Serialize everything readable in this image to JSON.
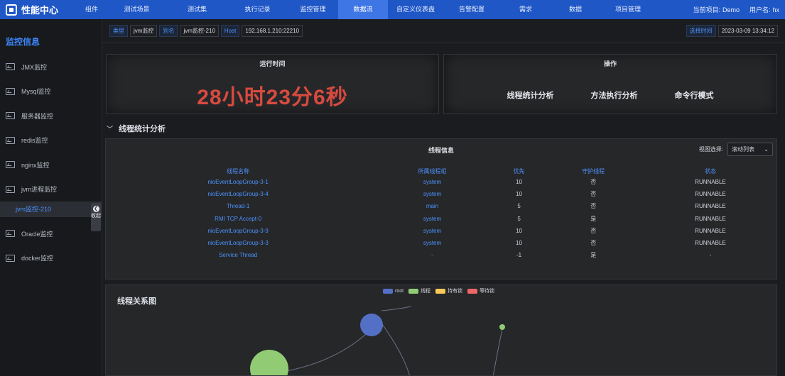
{
  "app": {
    "title": "性能中心"
  },
  "nav": [
    {
      "label": "组件",
      "w": 42
    },
    {
      "label": "测试场景",
      "w": 85
    },
    {
      "label": "测试集",
      "w": 85
    },
    {
      "label": "执行记录",
      "w": 85
    },
    {
      "label": "监控管理",
      "w": 71
    },
    {
      "label": "数据流",
      "w": 70,
      "active": true
    },
    {
      "label": "自定义仪表盘",
      "w": 78
    },
    {
      "label": "告警配置",
      "w": 80
    },
    {
      "label": "需求",
      "w": 72
    },
    {
      "label": "数据",
      "w": 68
    },
    {
      "label": "项目管理",
      "w": 80
    }
  ],
  "top_right": {
    "project_label": "当前项目:",
    "project": "Demo",
    "user_label": "用户名:",
    "user": "hx"
  },
  "sidebar": {
    "title": "监控信息",
    "items": [
      "JMX监控",
      "Mysql监控",
      "服务器监控",
      "redis监控",
      "nginx监控",
      "jvm进程监控"
    ],
    "sub_item": "jvm监控-210",
    "items_after": [
      "Oracle监控",
      "docker监控"
    ],
    "collapse": {
      "icon": "❮",
      "text": "收起"
    }
  },
  "infobar": {
    "type_label": "类型",
    "type_value": "jvm监控",
    "alias_label": "别名",
    "alias_value": "jvm监控-210",
    "host_label": "Host",
    "host_value": "192.168.1.210:22210",
    "time_label": "选择时间",
    "time_value": "2023-03-09 13:34:12"
  },
  "runtime": {
    "title": "运行时间",
    "value": "28小时23分6秒"
  },
  "ops": {
    "title": "操作",
    "items": [
      "线程统计分析",
      "方法执行分析",
      "命令行模式"
    ]
  },
  "section": {
    "title": "线程统计分析"
  },
  "thread_panel": {
    "title": "线程信息",
    "view_label": "视图选择:",
    "view_value": "滚动列表",
    "columns": [
      "线程名称",
      "所属线程组",
      "优先",
      "守护线程",
      "状态"
    ],
    "rows": [
      [
        "nioEventLoopGroup-3-1",
        "system",
        "10",
        "否",
        "RUNNABLE"
      ],
      [
        "nioEventLoopGroup-3-4",
        "system",
        "10",
        "否",
        "RUNNABLE"
      ],
      [
        "Thread-1",
        "main",
        "5",
        "否",
        "RUNNABLE"
      ],
      [
        "RMI TCP Accept-0",
        "system",
        "5",
        "是",
        "RUNNABLE"
      ],
      [
        "nioEventLoopGroup-3-9",
        "system",
        "10",
        "否",
        "RUNNABLE"
      ],
      [
        "nioEventLoopGroup-3-3",
        "system",
        "10",
        "否",
        "RUNNABLE"
      ],
      [
        "Service Thread",
        "-",
        "-1",
        "是",
        "-"
      ]
    ]
  },
  "graph": {
    "title": "线程关系图",
    "legend": [
      {
        "name": "root",
        "color": "#5470c6"
      },
      {
        "name": "线程",
        "color": "#91cc75"
      },
      {
        "name": "持有锁",
        "color": "#fac858"
      },
      {
        "name": "等待锁",
        "color": "#ee6666"
      }
    ]
  }
}
